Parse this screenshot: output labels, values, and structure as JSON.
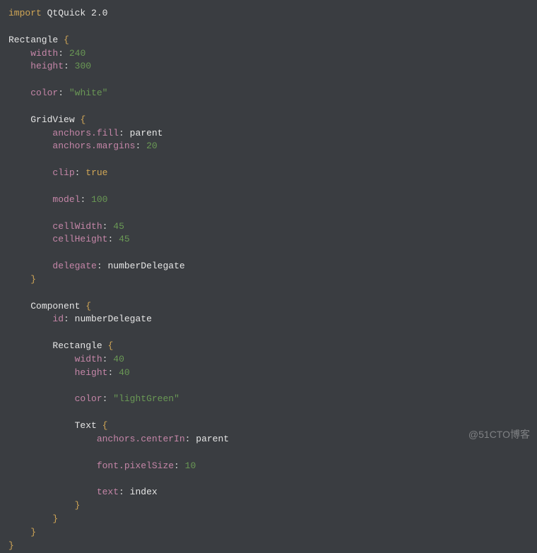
{
  "code": {
    "import_kw": "import",
    "module": "QtQuick",
    "version": "2.0",
    "root_type": "Rectangle",
    "root": {
      "width_k": "width",
      "width_v": "240",
      "height_k": "height",
      "height_v": "300",
      "color_k": "color",
      "color_v": "\"white\"",
      "gridview_type": "GridView",
      "gridview": {
        "anchors_fill_k": "anchors.fill",
        "anchors_fill_v": "parent",
        "anchors_margins_k": "anchors.margins",
        "anchors_margins_v": "20",
        "clip_k": "clip",
        "clip_v": "true",
        "model_k": "model",
        "model_v": "100",
        "cellWidth_k": "cellWidth",
        "cellWidth_v": "45",
        "cellHeight_k": "cellHeight",
        "cellHeight_v": "45",
        "delegate_k": "delegate",
        "delegate_v": "numberDelegate"
      },
      "component_type": "Component",
      "component": {
        "id_k": "id",
        "id_v": "numberDelegate",
        "rect_type": "Rectangle",
        "rect": {
          "width_k": "width",
          "width_v": "40",
          "height_k": "height",
          "height_v": "40",
          "color_k": "color",
          "color_v": "\"lightGreen\"",
          "text_type": "Text",
          "text": {
            "anchors_centerIn_k": "anchors.centerIn",
            "anchors_centerIn_v": "parent",
            "font_pixelSize_k": "font.pixelSize",
            "font_pixelSize_v": "10",
            "text_k": "text",
            "text_v": "index"
          }
        }
      }
    }
  },
  "braces": {
    "open": "{",
    "close": "}"
  },
  "watermark": "@51CTO博客"
}
